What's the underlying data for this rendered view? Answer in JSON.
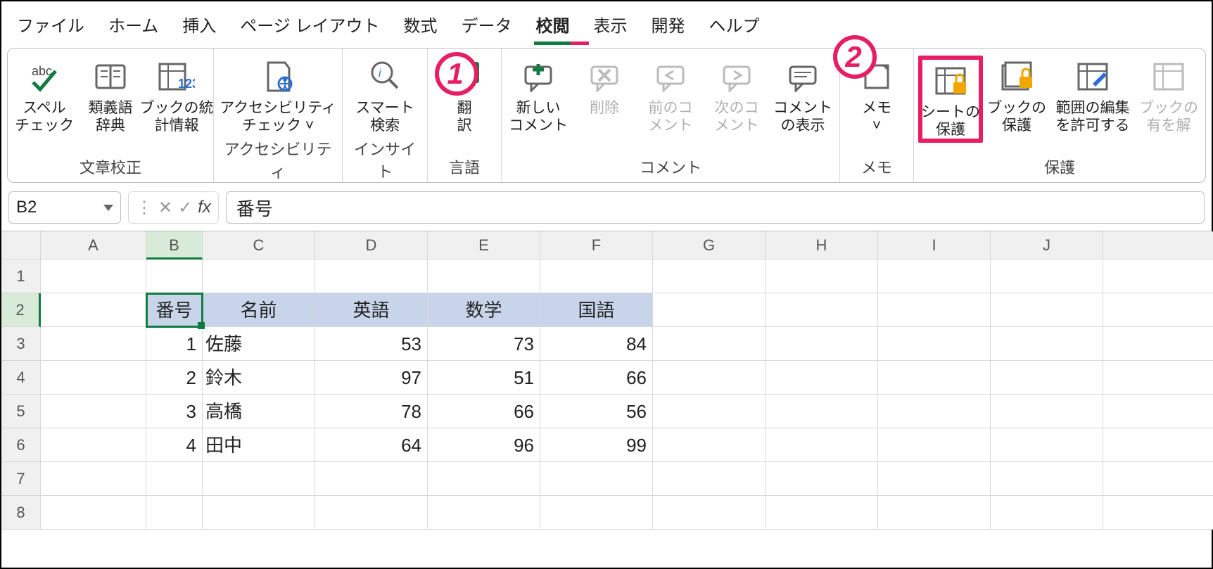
{
  "tabs": {
    "items": [
      {
        "label": "ファイル"
      },
      {
        "label": "ホーム"
      },
      {
        "label": "挿入"
      },
      {
        "label": "ページ レイアウト"
      },
      {
        "label": "数式"
      },
      {
        "label": "データ"
      },
      {
        "label": "校閲"
      },
      {
        "label": "表示"
      },
      {
        "label": "開発"
      },
      {
        "label": "ヘルプ"
      }
    ],
    "active_index": 6
  },
  "callouts": {
    "1": "1",
    "2": "2"
  },
  "ribbon": {
    "groups": [
      {
        "name": "文章校正",
        "buttons": [
          {
            "l1": "スペル",
            "l2": "チェック",
            "icon": "spellcheck-icon"
          },
          {
            "l1": "類義語",
            "l2": "辞典",
            "icon": "thesaurus-icon"
          },
          {
            "l1": "ブックの統",
            "l2": "計情報",
            "icon": "workbook-stats-icon"
          }
        ]
      },
      {
        "name": "アクセシビリティ",
        "buttons": [
          {
            "l1": "アクセシビリティ",
            "l2": "チェック ˅",
            "icon": "accessibility-icon"
          }
        ]
      },
      {
        "name": "インサイト",
        "buttons": [
          {
            "l1": "スマート",
            "l2": "検索",
            "icon": "smart-lookup-icon"
          }
        ]
      },
      {
        "name": "言語",
        "buttons": [
          {
            "l1": "翻",
            "l2": "訳",
            "icon": "translate-icon"
          }
        ]
      },
      {
        "name": "コメント",
        "buttons": [
          {
            "l1": "新しい",
            "l2": "コメント",
            "icon": "new-comment-icon"
          },
          {
            "l1": "削除",
            "l2": "",
            "icon": "delete-comment-icon",
            "disabled": true
          },
          {
            "l1": "前のコ",
            "l2": "メント",
            "icon": "previous-comment-icon",
            "disabled": true
          },
          {
            "l1": "次のコ",
            "l2": "メント",
            "icon": "next-comment-icon",
            "disabled": true
          },
          {
            "l1": "コメント",
            "l2": "の表示",
            "icon": "show-comments-icon"
          }
        ]
      },
      {
        "name": "メモ",
        "buttons": [
          {
            "l1": "メモ",
            "l2": "˅",
            "icon": "notes-icon"
          }
        ]
      },
      {
        "name": "保護",
        "buttons": [
          {
            "l1": "シートの",
            "l2": "保護",
            "icon": "protect-sheet-icon",
            "highlight": true
          },
          {
            "l1": "ブックの",
            "l2": "保護",
            "icon": "protect-workbook-icon"
          },
          {
            "l1": "範囲の編集",
            "l2": "を許可する",
            "icon": "allow-edit-ranges-icon"
          },
          {
            "l1": "ブックの",
            "l2": "有を解",
            "icon": "unshare-workbook-icon",
            "disabled": true
          }
        ]
      }
    ]
  },
  "formula_bar": {
    "name_box": "B2",
    "formula": "番号"
  },
  "grid": {
    "columns": [
      "A",
      "B",
      "C",
      "D",
      "E",
      "F",
      "G",
      "H",
      "I",
      "J"
    ],
    "row_count": 8,
    "active_cell": "B2",
    "active_col_index": 1,
    "active_row_index": 1,
    "header_row": 2,
    "headers": {
      "B": "番号",
      "C": "名前",
      "D": "英語",
      "E": "数学",
      "F": "国語"
    },
    "rows": [
      {
        "B": "1",
        "C": "佐藤",
        "D": "53",
        "E": "73",
        "F": "84"
      },
      {
        "B": "2",
        "C": "鈴木",
        "D": "97",
        "E": "51",
        "F": "66"
      },
      {
        "B": "3",
        "C": "高橋",
        "D": "78",
        "E": "66",
        "F": "56"
      },
      {
        "B": "4",
        "C": "田中",
        "D": "64",
        "E": "96",
        "F": "99"
      }
    ]
  }
}
